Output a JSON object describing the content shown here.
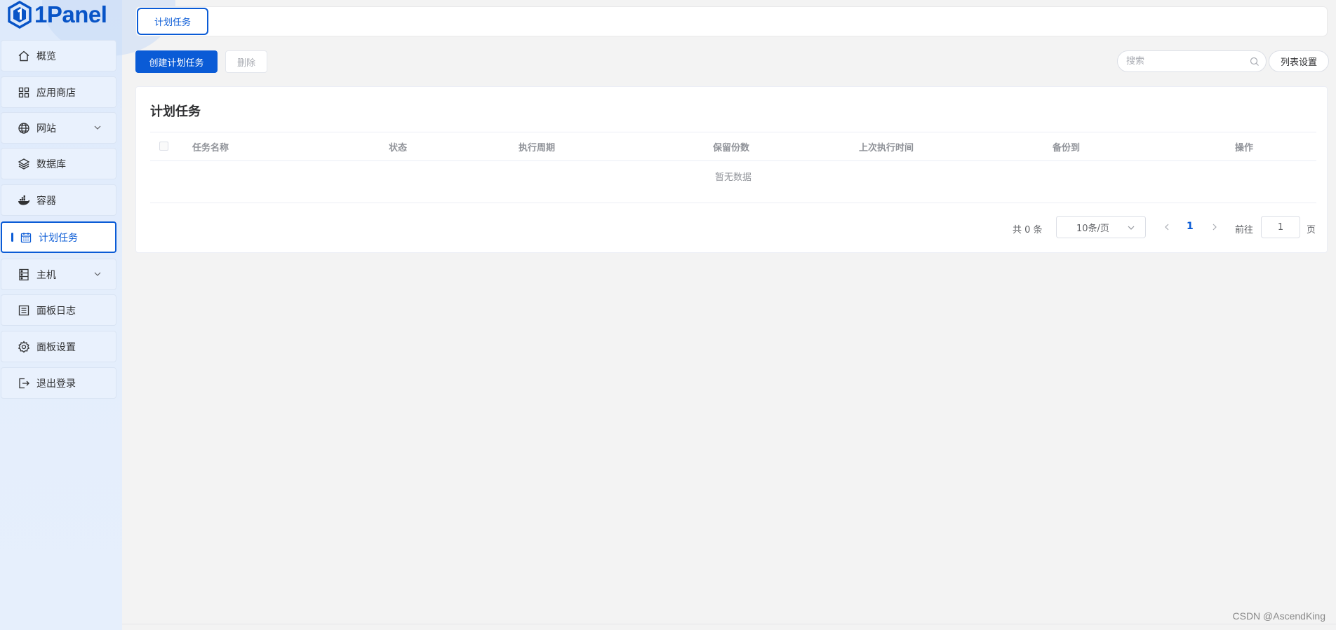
{
  "app": {
    "logo_text": "1Panel"
  },
  "sidebar": {
    "items": [
      {
        "label": "概览",
        "icon": "home-icon"
      },
      {
        "label": "应用商店",
        "icon": "apps-grid-icon"
      },
      {
        "label": "网站",
        "icon": "globe-icon",
        "expandable": true
      },
      {
        "label": "数据库",
        "icon": "layers-icon"
      },
      {
        "label": "容器",
        "icon": "docker-icon"
      },
      {
        "label": "计划任务",
        "icon": "calendar-icon",
        "active": true
      },
      {
        "label": "主机",
        "icon": "server-icon",
        "expandable": true
      },
      {
        "label": "面板日志",
        "icon": "log-list-icon"
      },
      {
        "label": "面板设置",
        "icon": "gear-icon"
      },
      {
        "label": "退出登录",
        "icon": "logout-icon"
      }
    ]
  },
  "header": {
    "tab_label": "计划任务"
  },
  "toolbar": {
    "create_label": "创建计划任务",
    "delete_label": "删除",
    "search_placeholder": "搜索",
    "column_settings_label": "列表设置"
  },
  "card": {
    "title": "计划任务",
    "columns": [
      "任务名称",
      "状态",
      "执行周期",
      "保留份数",
      "上次执行时间",
      "备份到",
      "操作"
    ],
    "empty_text": "暂无数据"
  },
  "pagination": {
    "total_text": "共 0 条",
    "page_size": "10条/页",
    "current_page": "1",
    "goto_label": "前往",
    "goto_value": "1",
    "page_suffix": "页"
  },
  "watermark": "CSDN @AscendKing",
  "colors": {
    "accent": "#0a5bd6",
    "sidebar_bg": "#e4eefc",
    "page_bg": "#f3f3f3"
  }
}
